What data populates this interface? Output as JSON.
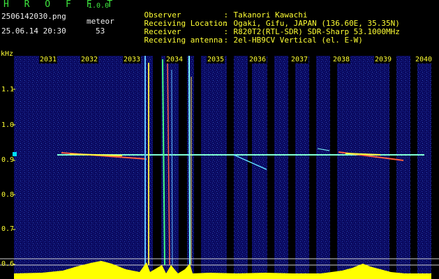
{
  "header": {
    "app_name": "H R O F F T",
    "version": "1.0.0",
    "filename": "2506142030.png",
    "meteor_label": "meteor",
    "timestamp": "25.06.14 20:30",
    "meteor_count": "53",
    "info": [
      {
        "key": "Observer",
        "value": "Takanori Kawachi"
      },
      {
        "key": "Receiving Location",
        "value": "Ogaki, Gifu, JAPAN (136.60E, 35.35N)"
      },
      {
        "key": "Receiver",
        "value": "R820T2(RTL-SDR) SDR-Sharp 53.1000MHz"
      },
      {
        "key": "Receiving antenna",
        "value": "2el-HB9CV Vertical (el. E-W)"
      }
    ]
  },
  "spectrogram": {
    "y_unit": "kHz",
    "y_ticks": [
      "1.1",
      "1.0",
      "0.9",
      "0.8",
      "0.7",
      "0.6"
    ],
    "x_ticks": [
      "2031",
      "2032",
      "2033",
      "2034",
      "2035",
      "2036",
      "2037",
      "2038",
      "2039",
      "2040"
    ],
    "colors": {
      "background": "#0a0a60",
      "axis_text": "#ffff33",
      "activity": "#ffff00",
      "carrier": "#7fffd4"
    }
  }
}
